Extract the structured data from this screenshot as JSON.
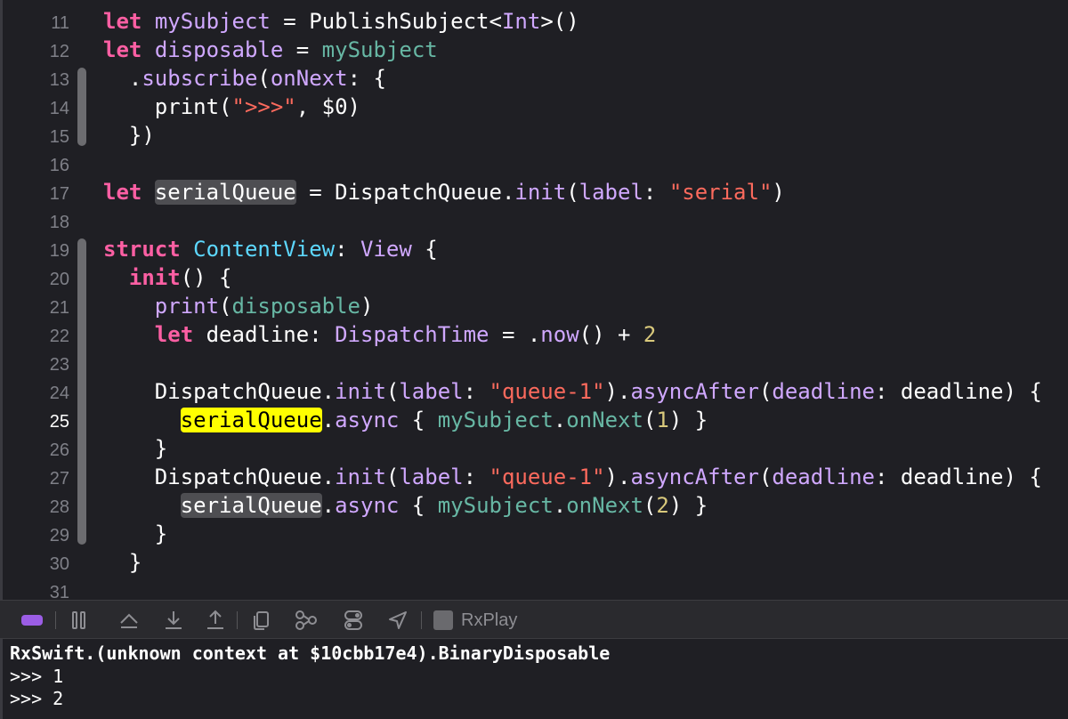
{
  "editor": {
    "lines": [
      {
        "num": "11",
        "tokens": [
          {
            "t": "let",
            "c": "k"
          },
          {
            "t": " "
          },
          {
            "t": "mySubject",
            "c": "p"
          },
          {
            "t": " = PublishSubject<"
          },
          {
            "t": "Int",
            "c": "p"
          },
          {
            "t": ">()"
          }
        ]
      },
      {
        "num": "12",
        "tokens": [
          {
            "t": "let",
            "c": "k"
          },
          {
            "t": " "
          },
          {
            "t": "disposable",
            "c": "p"
          },
          {
            "t": " = "
          },
          {
            "t": "mySubject",
            "c": "g"
          }
        ]
      },
      {
        "num": "13",
        "tokens": [
          {
            "t": "  ."
          },
          {
            "t": "subscribe",
            "c": "p"
          },
          {
            "t": "("
          },
          {
            "t": "onNext",
            "c": "p"
          },
          {
            "t": ": {"
          }
        ]
      },
      {
        "num": "14",
        "tokens": [
          {
            "t": "    print("
          },
          {
            "t": "\">>>\"",
            "c": "s"
          },
          {
            "t": ", $0)"
          }
        ]
      },
      {
        "num": "15",
        "tokens": [
          {
            "t": "  })"
          }
        ]
      },
      {
        "num": "16",
        "tokens": []
      },
      {
        "num": "17",
        "tokens": [
          {
            "t": "let",
            "c": "k"
          },
          {
            "t": " "
          },
          {
            "t": "serialQueue",
            "c": "hl-gray"
          },
          {
            "t": " = DispatchQueue."
          },
          {
            "t": "init",
            "c": "p"
          },
          {
            "t": "("
          },
          {
            "t": "label",
            "c": "p"
          },
          {
            "t": ": "
          },
          {
            "t": "\"serial\"",
            "c": "s"
          },
          {
            "t": ")"
          }
        ]
      },
      {
        "num": "18",
        "tokens": []
      },
      {
        "num": "19",
        "tokens": [
          {
            "t": "struct",
            "c": "k"
          },
          {
            "t": " "
          },
          {
            "t": "ContentView",
            "c": "t"
          },
          {
            "t": ": "
          },
          {
            "t": "View",
            "c": "p"
          },
          {
            "t": " {"
          }
        ]
      },
      {
        "num": "20",
        "tokens": [
          {
            "t": "  "
          },
          {
            "t": "init",
            "c": "k"
          },
          {
            "t": "() {"
          }
        ]
      },
      {
        "num": "21",
        "tokens": [
          {
            "t": "    "
          },
          {
            "t": "print",
            "c": "p"
          },
          {
            "t": "("
          },
          {
            "t": "disposable",
            "c": "g"
          },
          {
            "t": ")"
          }
        ]
      },
      {
        "num": "22",
        "tokens": [
          {
            "t": "    "
          },
          {
            "t": "let",
            "c": "k"
          },
          {
            "t": " deadline: "
          },
          {
            "t": "DispatchTime",
            "c": "p"
          },
          {
            "t": " = ."
          },
          {
            "t": "now",
            "c": "p"
          },
          {
            "t": "() + "
          },
          {
            "t": "2",
            "c": "n"
          }
        ]
      },
      {
        "num": "23",
        "tokens": []
      },
      {
        "num": "24",
        "tokens": [
          {
            "t": "    DispatchQueue."
          },
          {
            "t": "init",
            "c": "p"
          },
          {
            "t": "("
          },
          {
            "t": "label",
            "c": "p"
          },
          {
            "t": ": "
          },
          {
            "t": "\"queue-1\"",
            "c": "s"
          },
          {
            "t": ")."
          },
          {
            "t": "asyncAfter",
            "c": "p"
          },
          {
            "t": "("
          },
          {
            "t": "deadline",
            "c": "p"
          },
          {
            "t": ": deadline) {"
          }
        ]
      },
      {
        "num": "25",
        "current": true,
        "tokens": [
          {
            "t": "      "
          },
          {
            "t": "serialQueue",
            "c": "hl-yellow"
          },
          {
            "t": "."
          },
          {
            "t": "async",
            "c": "p"
          },
          {
            "t": " { "
          },
          {
            "t": "mySubject",
            "c": "g"
          },
          {
            "t": "."
          },
          {
            "t": "onNext",
            "c": "g"
          },
          {
            "t": "("
          },
          {
            "t": "1",
            "c": "n"
          },
          {
            "t": ") }"
          }
        ]
      },
      {
        "num": "26",
        "tokens": [
          {
            "t": "    }"
          }
        ]
      },
      {
        "num": "27",
        "tokens": [
          {
            "t": "    DispatchQueue."
          },
          {
            "t": "init",
            "c": "p"
          },
          {
            "t": "("
          },
          {
            "t": "label",
            "c": "p"
          },
          {
            "t": ": "
          },
          {
            "t": "\"queue-1\"",
            "c": "s"
          },
          {
            "t": ")."
          },
          {
            "t": "asyncAfter",
            "c": "p"
          },
          {
            "t": "("
          },
          {
            "t": "deadline",
            "c": "p"
          },
          {
            "t": ": deadline) {"
          }
        ]
      },
      {
        "num": "28",
        "tokens": [
          {
            "t": "      "
          },
          {
            "t": "serialQueue",
            "c": "hl-gray"
          },
          {
            "t": "."
          },
          {
            "t": "async",
            "c": "p"
          },
          {
            "t": " { "
          },
          {
            "t": "mySubject",
            "c": "g"
          },
          {
            "t": "."
          },
          {
            "t": "onNext",
            "c": "g"
          },
          {
            "t": "("
          },
          {
            "t": "2",
            "c": "n"
          },
          {
            "t": ") }"
          }
        ]
      },
      {
        "num": "29",
        "tokens": [
          {
            "t": "    }"
          }
        ]
      },
      {
        "num": "30",
        "tokens": [
          {
            "t": "  }"
          }
        ]
      },
      {
        "num": "31",
        "tokens": []
      }
    ]
  },
  "debugbar": {
    "scheme_label": "RxPlay",
    "icons": [
      "hide-debug-area-icon",
      "pause-icon",
      "step-over-icon",
      "step-into-icon",
      "step-out-icon",
      "view-hierarchy-icon",
      "memory-graph-icon",
      "environment-overrides-icon",
      "simulate-location-icon",
      "scheme-icon"
    ]
  },
  "console": {
    "lines": [
      "RxSwift.(unknown context at $10cbb17e4).BinaryDisposable",
      ">>> 1",
      ">>> 2"
    ]
  },
  "colors": {
    "background": "#1f1f24",
    "keyword": "#fc5fa3",
    "type": "#5dd8ff",
    "other_decl": "#d0a8ff",
    "string": "#fc6a5d",
    "number": "#d9c97c",
    "project_symbol": "#67b7a4",
    "instruction_highlight": "#ffff00"
  }
}
